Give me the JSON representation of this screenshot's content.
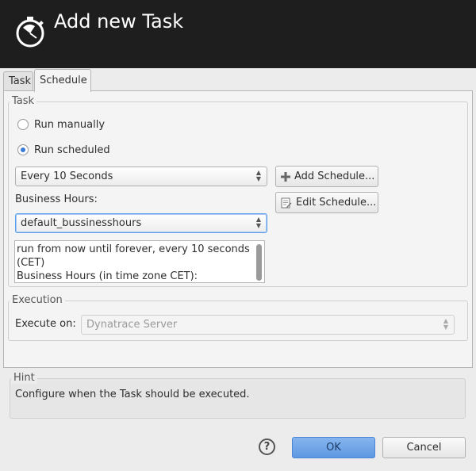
{
  "header": {
    "title": "Add new Task",
    "icon": "stopwatch-icon"
  },
  "tabs": [
    {
      "label": "Task",
      "active": false
    },
    {
      "label": "Schedule",
      "active": true
    }
  ],
  "task_group": {
    "legend": "Task",
    "run_manually_label": "Run manually",
    "run_manually_checked": false,
    "run_scheduled_label": "Run scheduled",
    "run_scheduled_checked": true,
    "schedule_select_value": "Every 10 Seconds",
    "add_schedule_label": "Add Schedule...",
    "add_schedule_icon": "plus-icon",
    "edit_schedule_label": "Edit Schedule...",
    "edit_schedule_icon": "edit-schedule-icon",
    "business_hours_label": "Business Hours:",
    "business_hours_value": "default_bussinesshours",
    "summary_lines": [
      "run from now until forever, every 10 seconds",
      "(CET)",
      "Business Hours (in time zone CET):"
    ]
  },
  "execution_group": {
    "legend": "Execution",
    "execute_on_label": "Execute on:",
    "execute_on_value": "Dynatrace Server"
  },
  "hint": {
    "legend": "Hint",
    "text": "Configure when the Task should be executed."
  },
  "footer": {
    "help_icon": "help-icon",
    "help_glyph": "?",
    "ok_label": "OK",
    "cancel_label": "Cancel"
  },
  "colors": {
    "header_bg": "#1e1e1e",
    "accent": "#5e98e2",
    "focus": "#5b9ee8"
  }
}
